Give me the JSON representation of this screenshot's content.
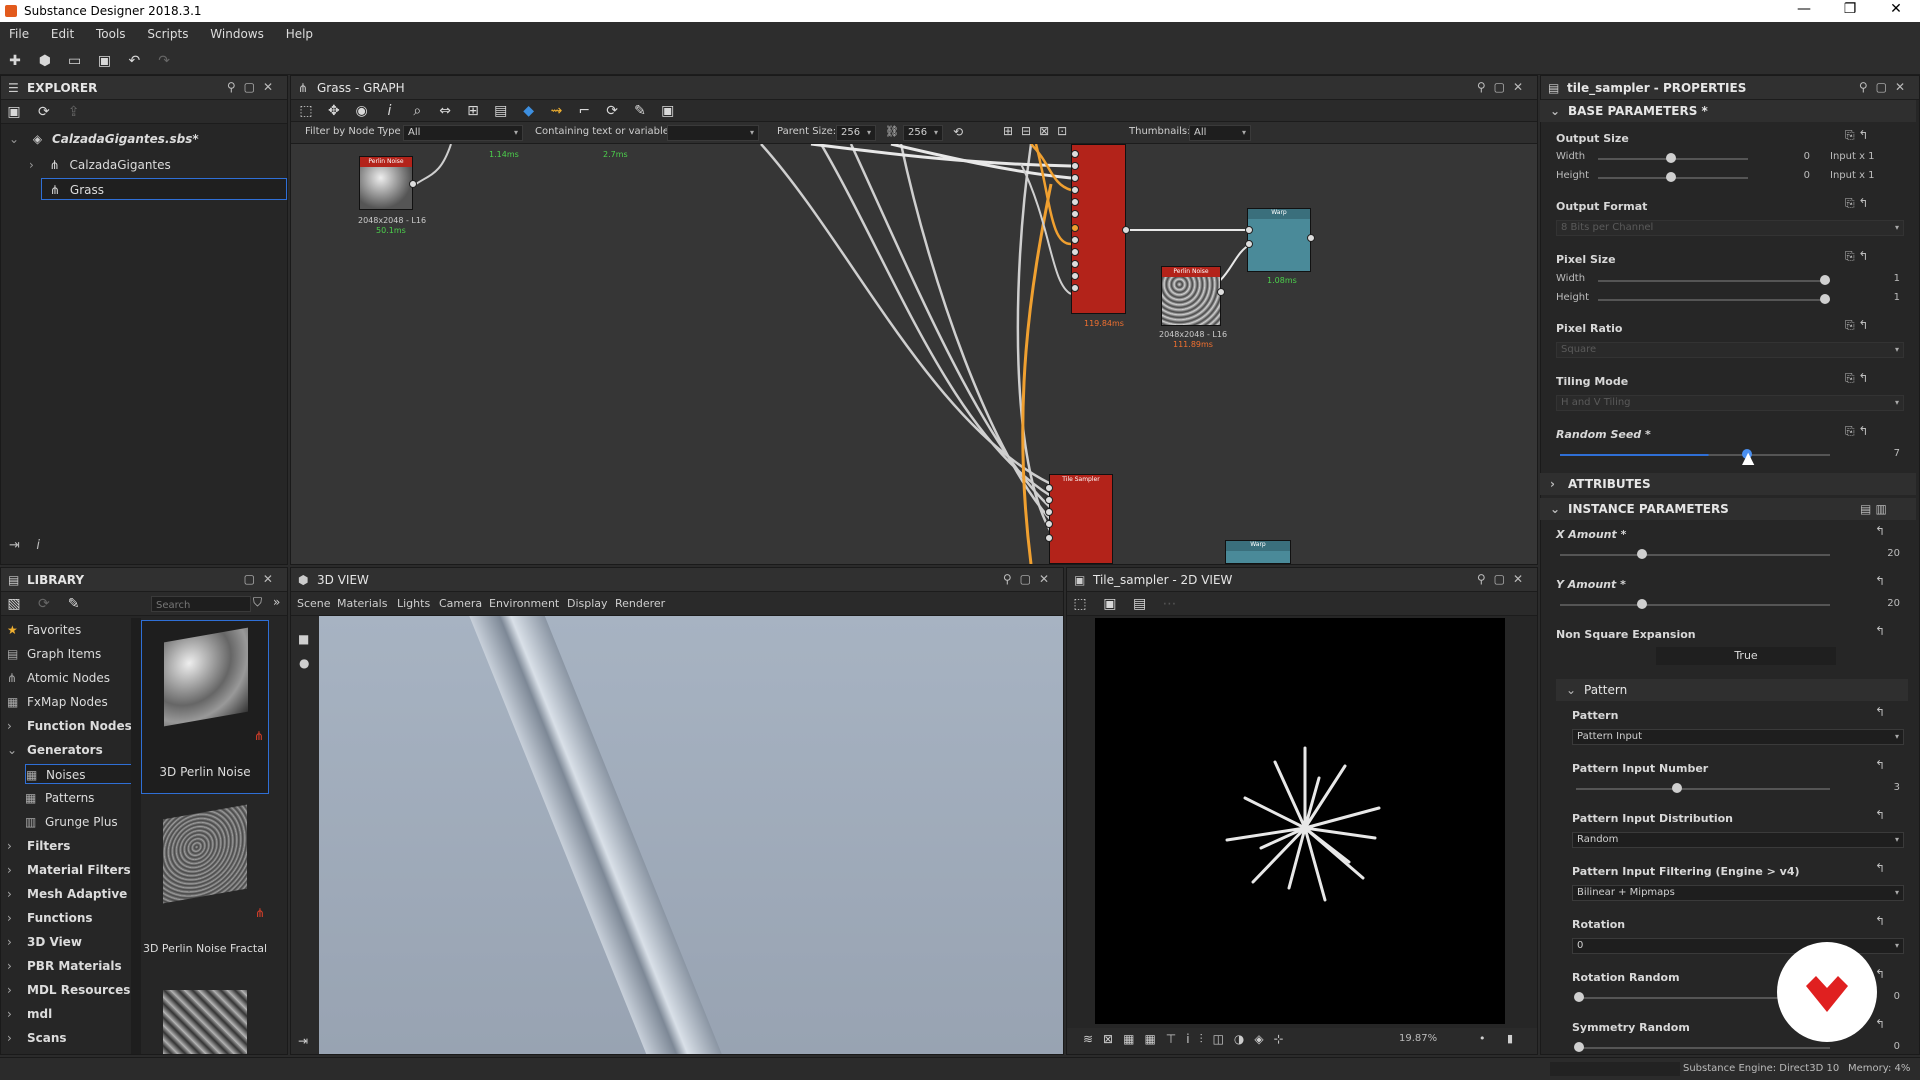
{
  "app": {
    "title": "Substance Designer 2018.3.1",
    "window_controls": [
      "—",
      "❐",
      "✕"
    ]
  },
  "menu": [
    "File",
    "Edit",
    "Tools",
    "Scripts",
    "Windows",
    "Help"
  ],
  "explorer": {
    "title": "EXPLORER",
    "package": "CalzadaGigantes.sbs*",
    "items": [
      "CalzadaGigantes",
      "Grass"
    ]
  },
  "graph": {
    "title": "Grass - GRAPH",
    "filter_label": "Filter by Node Type",
    "filter_value": "All",
    "containing_label": "Containing text or variable",
    "containing_value": "",
    "parent_size_label": "Parent Size:",
    "parent_w": "256",
    "parent_h": "256",
    "thumbnails_label": "Thumbnails:",
    "thumbnails_value": "All",
    "nodes": {
      "perlin1": {
        "name": "Perlin Noise",
        "res": "2048x2048 - L16",
        "time": "50.1ms"
      },
      "tile1": {
        "time": "119.84ms"
      },
      "perlin2": {
        "name": "Perlin Noise",
        "res": "2048x2048 - L16",
        "time": "111.89ms"
      },
      "warp1": {
        "name": "Warp",
        "time": "1.08ms"
      },
      "tile2": {
        "name": "Tile Sampler"
      },
      "warp2": {
        "name": "Warp"
      },
      "timeA": "1.14ms",
      "timeB": "2.7ms"
    }
  },
  "library": {
    "title": "LIBRARY",
    "search_placeholder": "Search",
    "categories": [
      {
        "label": "Favorites",
        "bold": false
      },
      {
        "label": "Graph Items",
        "bold": false
      },
      {
        "label": "Atomic Nodes",
        "bold": false
      },
      {
        "label": "FxMap Nodes",
        "bold": false
      },
      {
        "label": "Function Nodes",
        "bold": true
      },
      {
        "label": "Generators",
        "bold": true
      },
      {
        "label": "Noises",
        "bold": false
      },
      {
        "label": "Patterns",
        "bold": false
      },
      {
        "label": "Grunge Plus",
        "bold": false
      },
      {
        "label": "Filters",
        "bold": true
      },
      {
        "label": "Material Filters",
        "bold": true
      },
      {
        "label": "Mesh Adaptive",
        "bold": true
      },
      {
        "label": "Functions",
        "bold": true
      },
      {
        "label": "3D View",
        "bold": true
      },
      {
        "label": "PBR Materials",
        "bold": true
      },
      {
        "label": "MDL Resources",
        "bold": true
      },
      {
        "label": "mdl",
        "bold": true
      },
      {
        "label": "Scans",
        "bold": true
      }
    ],
    "thumbs": [
      "3D Perlin Noise",
      "3D Perlin Noise Fractal"
    ]
  },
  "view3d": {
    "title": "3D VIEW",
    "menu": [
      "Scene",
      "Materials",
      "Lights",
      "Camera",
      "Environment",
      "Display",
      "Renderer"
    ]
  },
  "view2d": {
    "title": "Tile_sampler - 2D VIEW",
    "zoom": "19.87%"
  },
  "properties": {
    "title": "tile_sampler - PROPERTIES",
    "base_section": "BASE PARAMETERS *",
    "output_size": {
      "label": "Output Size",
      "width_label": "Width",
      "height_label": "Height",
      "width_val": "0",
      "height_val": "0",
      "width_mode": "Input x 1",
      "height_mode": "Input x 1"
    },
    "output_format": {
      "label": "Output Format",
      "value": "8 Bits per Channel"
    },
    "pixel_size": {
      "label": "Pixel Size",
      "width_label": "Width",
      "height_label": "Height",
      "width_val": "1",
      "height_val": "1"
    },
    "pixel_ratio": {
      "label": "Pixel Ratio",
      "value": "Square"
    },
    "tiling_mode": {
      "label": "Tiling Mode",
      "value": "H and V Tiling"
    },
    "random_seed": {
      "label": "Random Seed *",
      "value": "7"
    },
    "attributes_section": "ATTRIBUTES",
    "instance_section": "INSTANCE PARAMETERS",
    "x_amount": {
      "label": "X Amount *",
      "value": "20"
    },
    "y_amount": {
      "label": "Y Amount *",
      "value": "20"
    },
    "non_square": {
      "label": "Non Square Expansion",
      "value": "True"
    },
    "pattern_group": "Pattern",
    "pattern": {
      "label": "Pattern",
      "value": "Pattern Input"
    },
    "pattern_input_number": {
      "label": "Pattern Input Number",
      "value": "3"
    },
    "pattern_input_distribution": {
      "label": "Pattern Input Distribution",
      "value": "Random"
    },
    "pattern_input_filtering": {
      "label": "Pattern Input Filtering (Engine > v4)",
      "value": "Bilinear + Mipmaps"
    },
    "rotation": {
      "label": "Rotation",
      "value": "0"
    },
    "rotation_random": {
      "label": "Rotation Random",
      "value": "0"
    },
    "symmetry_random": {
      "label": "Symmetry Random",
      "value": "0"
    }
  },
  "status": {
    "engine": "Substance Engine: Direct3D 10",
    "memory": "Memory: 4%"
  },
  "colors": {
    "accent": "#2f6fd6",
    "node_red": "#b3231a",
    "node_teal": "#4a8a99",
    "wire_orange": "#f0a030",
    "badge_red": "#e02020"
  }
}
